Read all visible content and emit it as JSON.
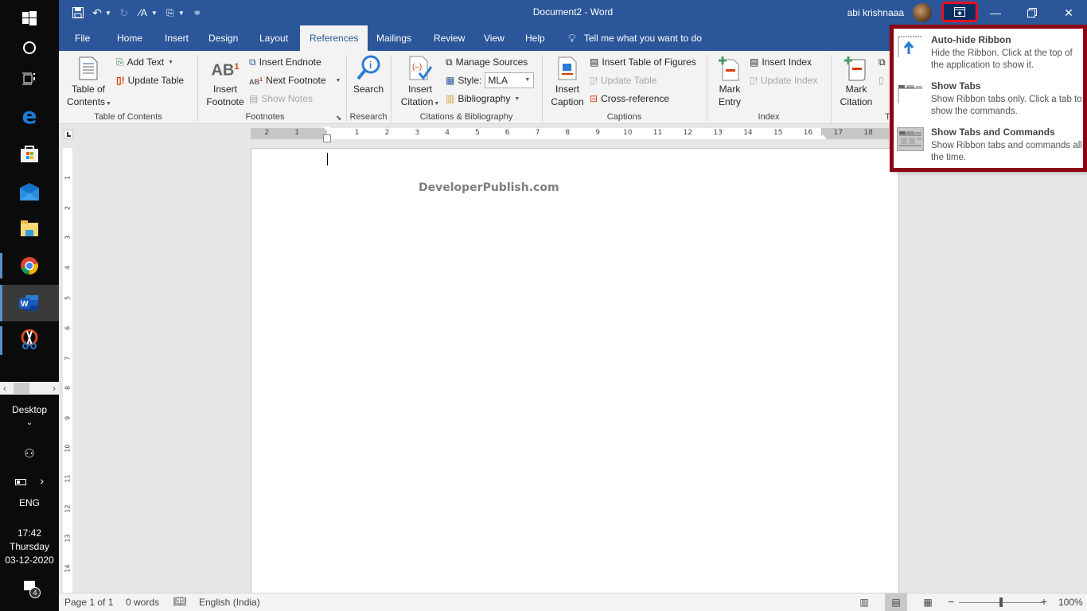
{
  "taskbar": {
    "icons": [
      "windows-start",
      "cortana-search",
      "task-view",
      "edge",
      "microsoft-store",
      "mail",
      "file-explorer",
      "chrome",
      "word",
      "snipping-tool"
    ],
    "desktop_label": "Desktop",
    "language": "ENG",
    "time": "17:42",
    "day": "Thursday",
    "date": "03-12-2020",
    "notification_count": "4"
  },
  "titlebar": {
    "title": "Document2  -  Word",
    "user": "abi krishnaaa",
    "qat": [
      "save",
      "undo",
      "redo",
      "font-size",
      "touch-mode",
      "customize"
    ]
  },
  "tabs": {
    "items": [
      "File",
      "Home",
      "Insert",
      "Design",
      "Layout",
      "References",
      "Mailings",
      "Review",
      "View",
      "Help"
    ],
    "active": "References",
    "tell_me": "Tell me what you want to do"
  },
  "ribbon": {
    "toc": {
      "big": "Table of Contents",
      "big_l1": "Table of",
      "big_l2": "Contents",
      "add_text": "Add Text",
      "update_table": "Update Table",
      "label": "Table of Contents"
    },
    "footnotes": {
      "big_l1": "Insert",
      "big_l2": "Footnote",
      "insert_endnote": "Insert Endnote",
      "next_footnote": "Next Footnote",
      "show_notes": "Show Notes",
      "label": "Footnotes"
    },
    "research": {
      "search": "Search",
      "label": "Research"
    },
    "citations": {
      "big_l1": "Insert",
      "big_l2": "Citation",
      "manage_sources": "Manage Sources",
      "style_label": "Style:",
      "style_value": "MLA",
      "bibliography": "Bibliography",
      "label": "Citations & Bibliography"
    },
    "captions": {
      "big_l1": "Insert",
      "big_l2": "Caption",
      "insert_tof": "Insert Table of Figures",
      "update_table": "Update Table",
      "cross_reference": "Cross-reference",
      "label": "Captions"
    },
    "index": {
      "big_l1": "Mark",
      "big_l2": "Entry",
      "insert_index": "Insert Index",
      "update_index": "Update Index",
      "label": "Index"
    },
    "toa": {
      "big_l1": "Mark",
      "big_l2": "Citation",
      "label": "Ta"
    }
  },
  "ruler": {
    "h_left": [
      "2",
      "1"
    ],
    "h_right": [
      "1",
      "2",
      "3",
      "4",
      "5",
      "6",
      "7",
      "8",
      "9",
      "10",
      "11",
      "12",
      "13",
      "14",
      "15",
      "16",
      "17",
      "18"
    ],
    "v": [
      "1",
      "2",
      "3",
      "4",
      "5",
      "6",
      "7",
      "8",
      "9",
      "10",
      "11",
      "12",
      "13",
      "14"
    ]
  },
  "document": {
    "watermark": "DeveloperPublish.com"
  },
  "statusbar": {
    "page": "Page 1 of 1",
    "words": "0 words",
    "language": "English (India)",
    "zoom": "100%",
    "zoom_percent": 100
  },
  "popup": {
    "items": [
      {
        "title": "Auto-hide Ribbon",
        "desc": "Hide the Ribbon. Click at the top of the application to show it.",
        "selected": false
      },
      {
        "title": "Show Tabs",
        "desc": "Show Ribbon tabs only. Click a tab to show the commands.",
        "selected": false
      },
      {
        "title": "Show Tabs and Commands",
        "desc": "Show Ribbon tabs and commands all the time.",
        "selected": true
      }
    ]
  },
  "colors": {
    "word_blue": "#2b579a",
    "popup_border": "#8b0014",
    "highlight_red": "#e81123"
  }
}
